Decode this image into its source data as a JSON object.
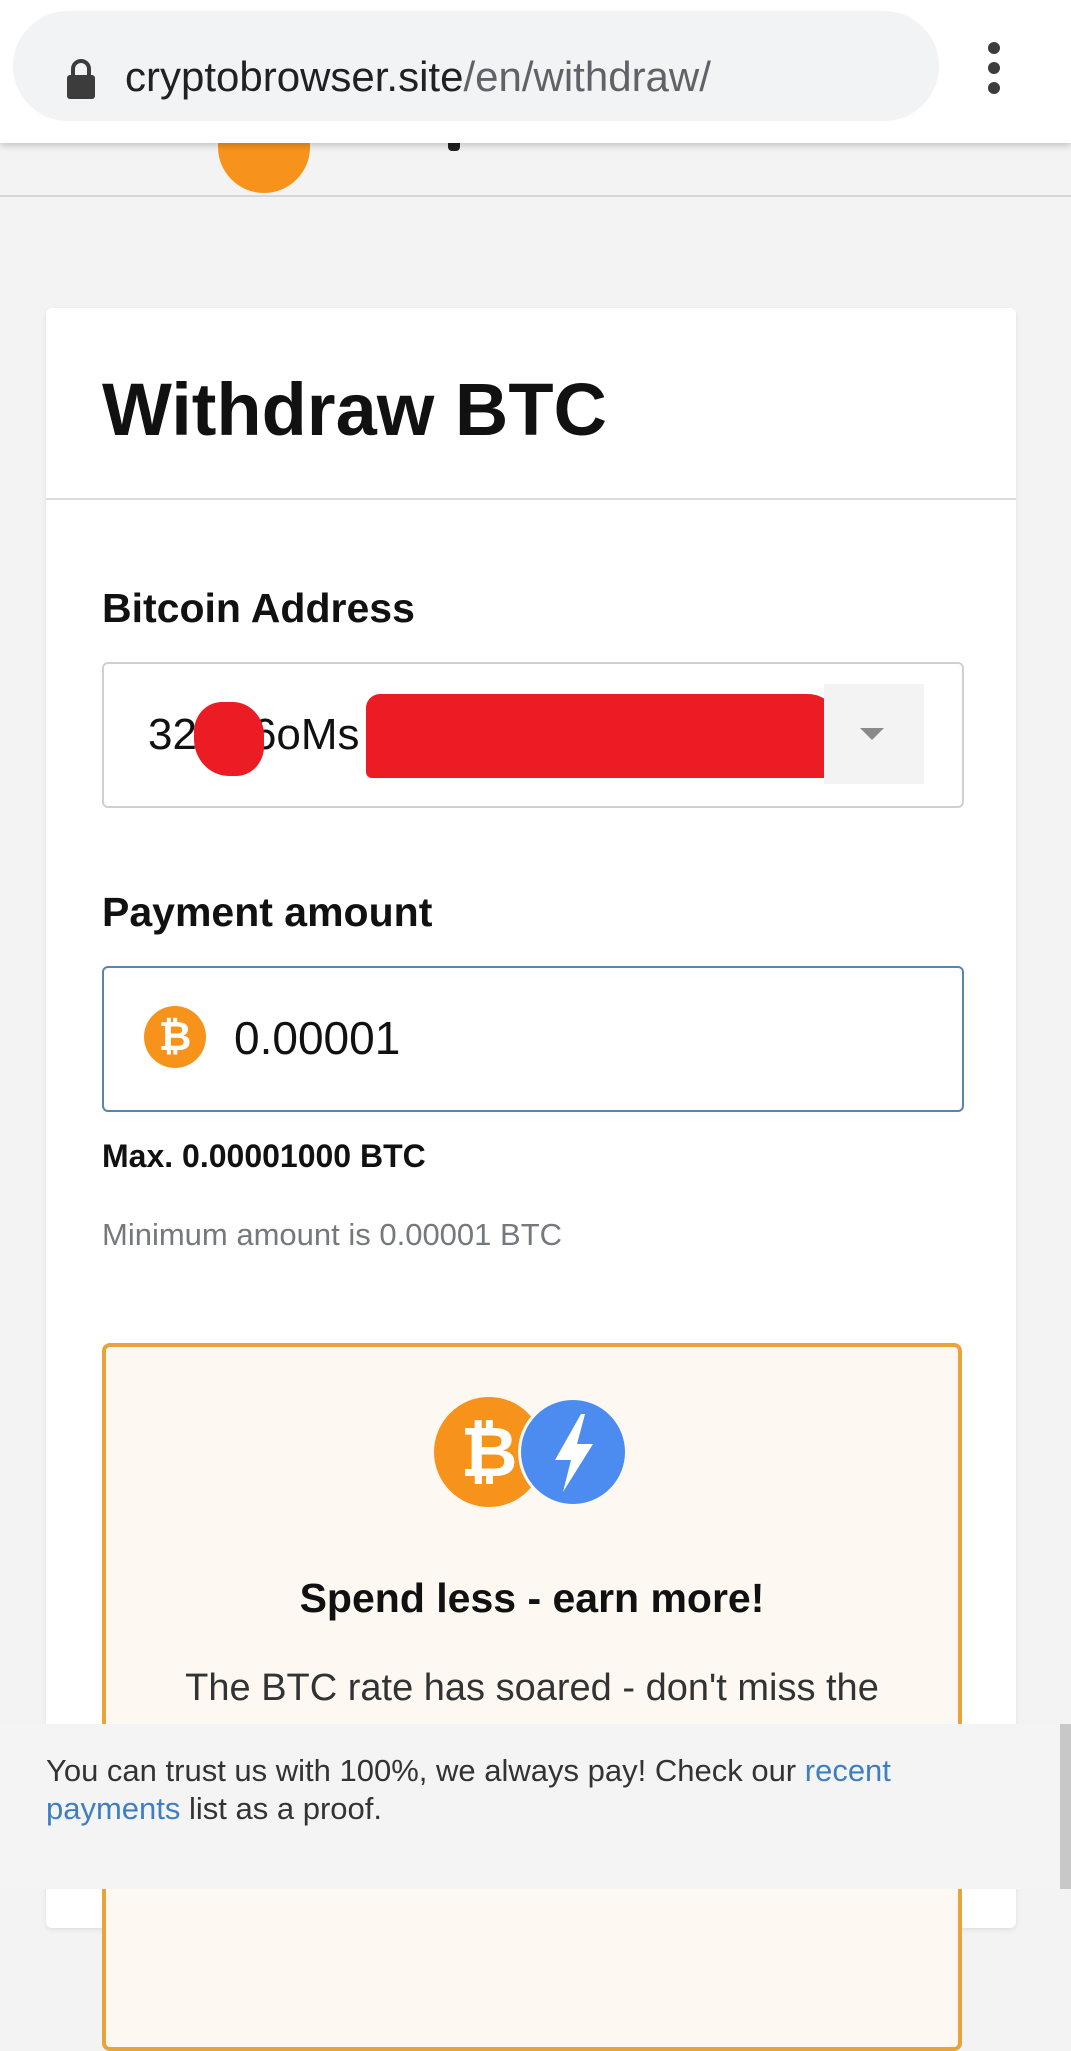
{
  "browser": {
    "url_host": "cryptobrowser.site",
    "url_path": "/en/withdraw/"
  },
  "card": {
    "title": "Withdraw BTC"
  },
  "address": {
    "label": "Bitcoin Address",
    "visible_start": "32",
    "visible_mid": "6oMs"
  },
  "amount": {
    "label": "Payment amount",
    "value": "0.00001",
    "currency_symbol": "₿"
  },
  "max_text": "Max. 0.00001000 BTC",
  "min_text": "Minimum amount is 0.00001 BTC",
  "promo": {
    "title": "Spend less - earn more!",
    "text": "The BTC rate has soared - don't miss the",
    "coin_symbol": "₿"
  },
  "notice": {
    "text_before": "You can trust us with 100%, we always pay! Check our ",
    "link_text": "recent payments",
    "text_after": " list as a proof."
  },
  "colors": {
    "btc_orange": "#f7931a",
    "bolt_blue": "#4c8bf0",
    "link_blue": "#3f7fc1",
    "redaction_red": "#ec1c24"
  }
}
